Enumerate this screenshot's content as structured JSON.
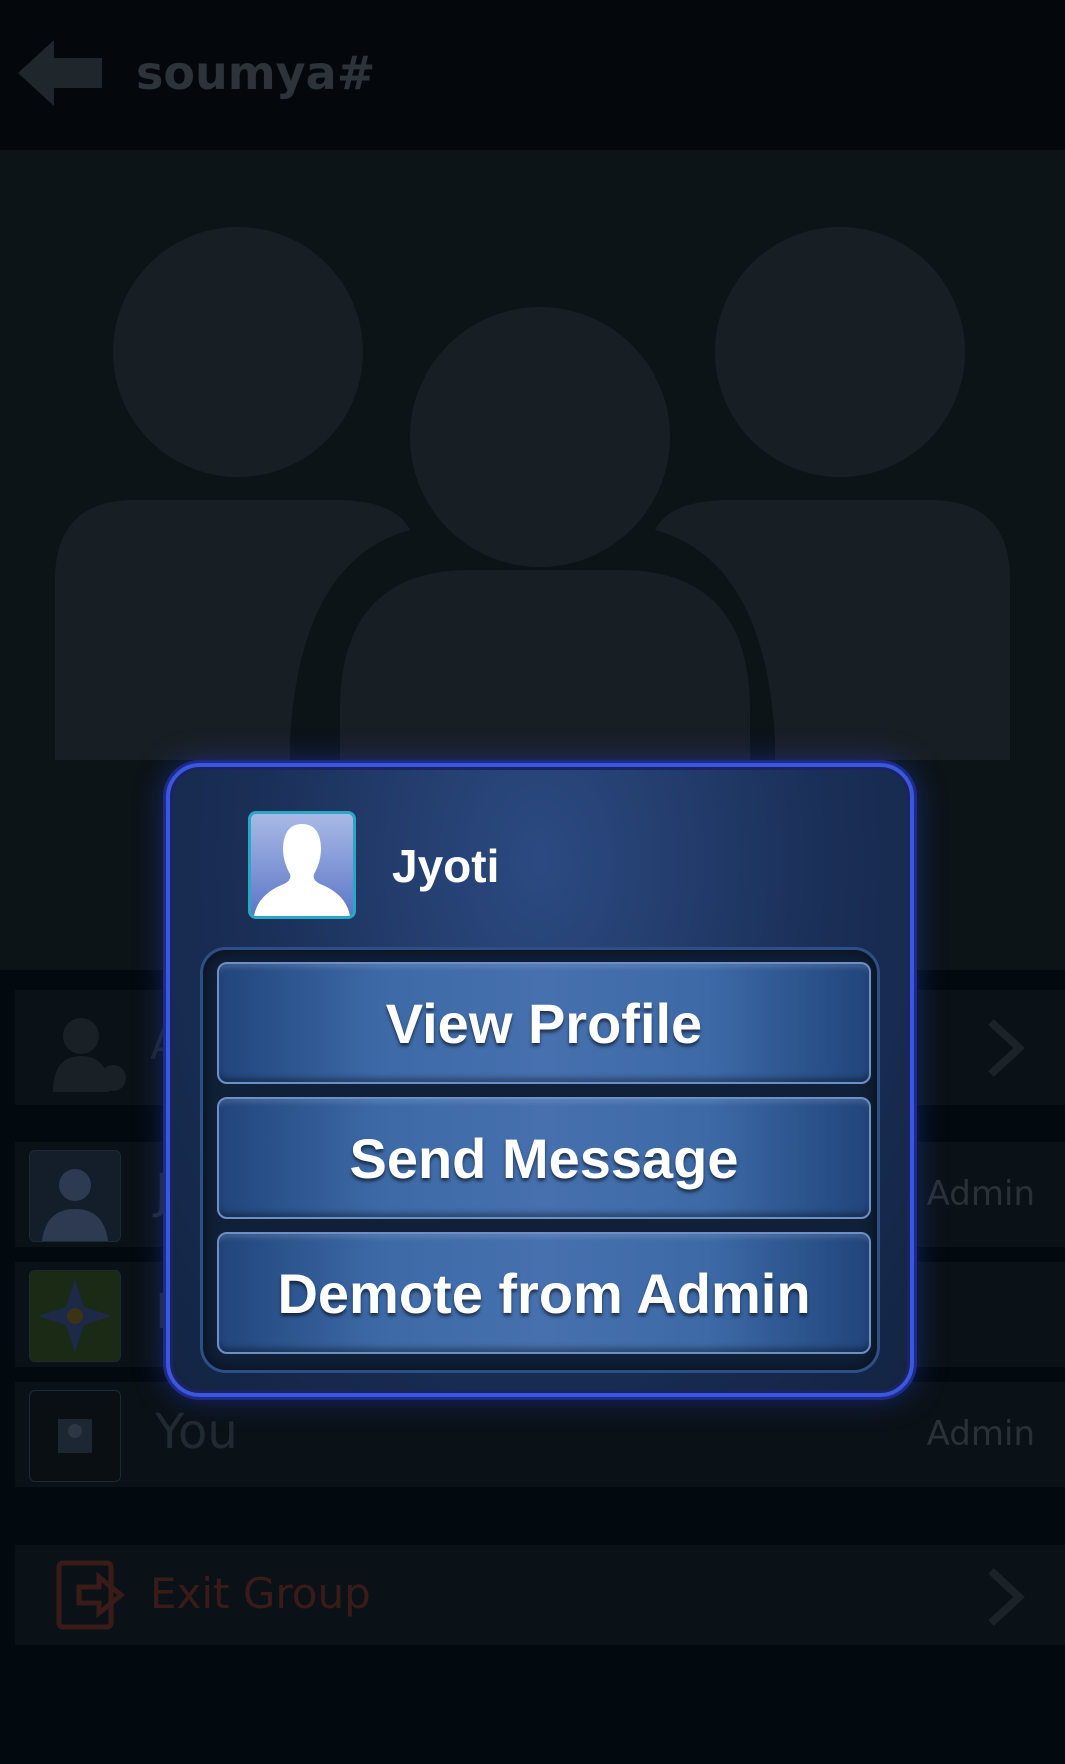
{
  "topbar": {
    "title": "soumya#"
  },
  "add_row": {
    "label": "A"
  },
  "members": [
    {
      "name": "J",
      "role": "Admin"
    },
    {
      "name": "I",
      "role": ""
    },
    {
      "name": "You",
      "role": "Admin"
    }
  ],
  "exit": {
    "label": "Exit Group"
  },
  "dialog": {
    "name": "Jyoti",
    "buttons": {
      "view_profile": "View Profile",
      "send_message": "Send Message",
      "demote": "Demote from Admin"
    }
  },
  "colors": {
    "dialog_border": "#3d56e0",
    "button_fill": "#3d6aa7",
    "exit_red": "#3a1b18"
  }
}
